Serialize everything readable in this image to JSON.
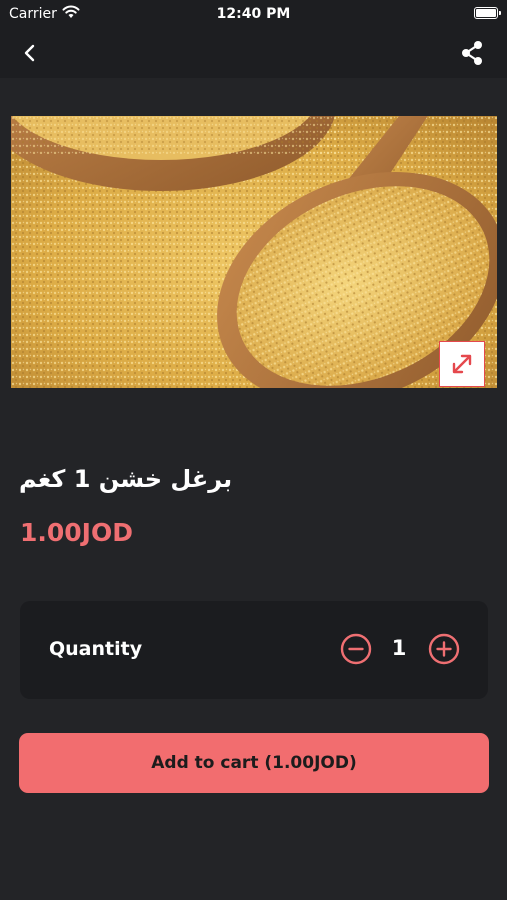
{
  "status_bar": {
    "carrier": "Carrier",
    "time": "12:40 PM"
  },
  "nav": {
    "back_icon": "chevron-left-icon",
    "share_icon": "share-icon"
  },
  "product": {
    "image_alt": "bulgur",
    "title": "برغل خشن 1 كغم",
    "price": "1.00JOD"
  },
  "quantity": {
    "label": "Quantity",
    "value": "1"
  },
  "cart": {
    "button_label": "Add to cart (1.00JOD)"
  },
  "colors": {
    "accent": "#f26d6f",
    "price": "#ef6f72",
    "background": "#232427",
    "card": "#1b1c1f"
  }
}
